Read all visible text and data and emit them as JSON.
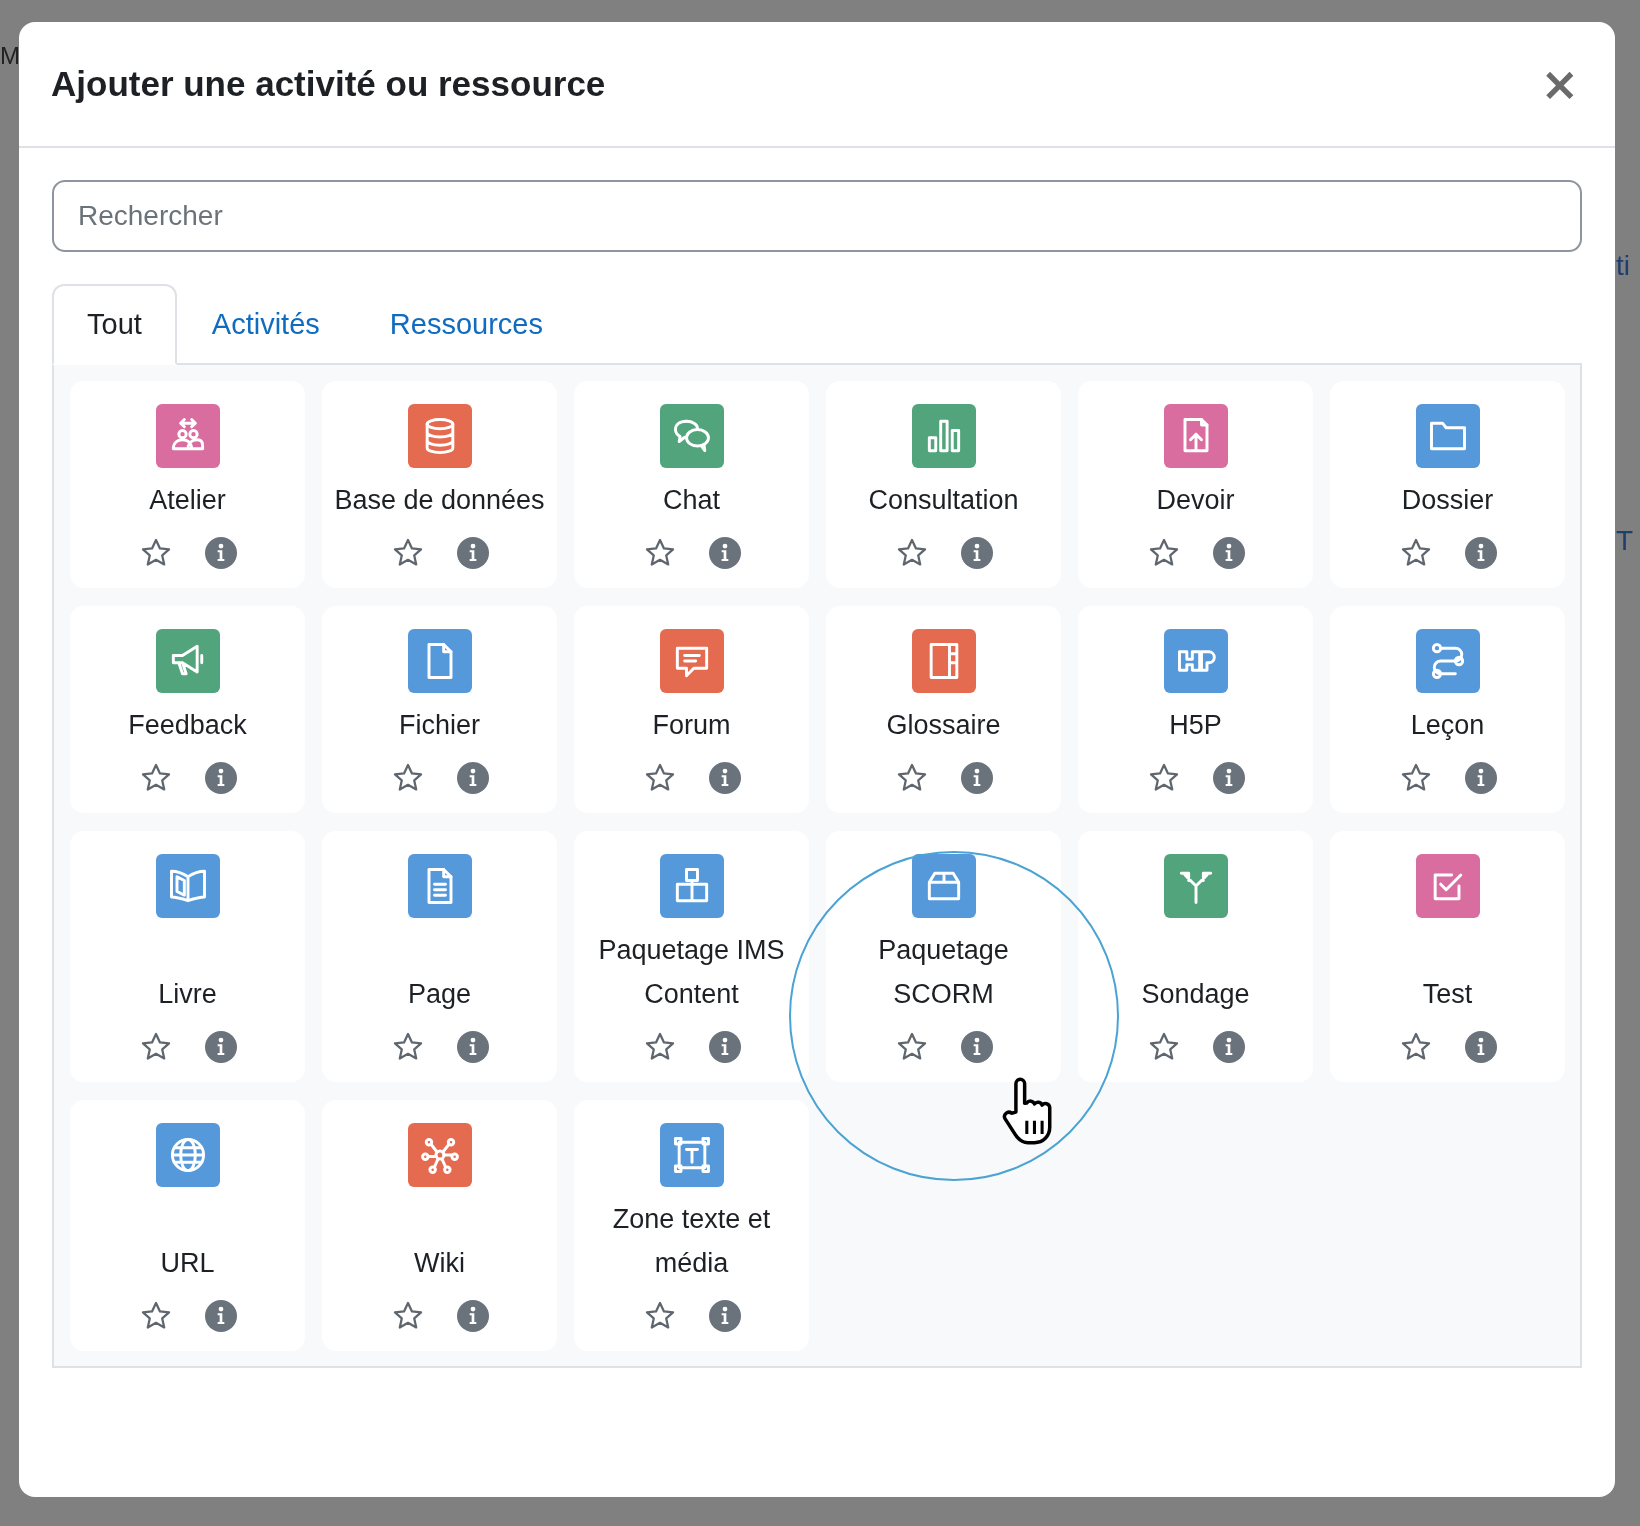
{
  "background": {
    "left_text": "M",
    "right_texts": [
      "ti",
      "T"
    ]
  },
  "dialog": {
    "title": "Ajouter une activité ou ressource",
    "close": "×"
  },
  "search": {
    "placeholder": "Rechercher"
  },
  "tabs": [
    {
      "label": "Tout",
      "selected": true
    },
    {
      "label": "Activités",
      "selected": false
    },
    {
      "label": "Ressources",
      "selected": false
    }
  ],
  "items": [
    {
      "label": "Atelier",
      "kind": "workshop",
      "color": "#d96da0",
      "starred": false
    },
    {
      "label": "Base de données",
      "kind": "database",
      "color": "#e46a50",
      "starred": false
    },
    {
      "label": "Chat",
      "kind": "chat",
      "color": "#51a47b",
      "starred": false
    },
    {
      "label": "Consultation",
      "kind": "chart",
      "color": "#51a47b",
      "starred": false
    },
    {
      "label": "Devoir",
      "kind": "upload",
      "color": "#d96da0",
      "starred": false
    },
    {
      "label": "Dossier",
      "kind": "folder",
      "color": "#5599db",
      "starred": false
    },
    {
      "label": "Feedback",
      "kind": "megaphone",
      "color": "#51a47b",
      "starred": false
    },
    {
      "label": "Fichier",
      "kind": "file",
      "color": "#5599db",
      "starred": false
    },
    {
      "label": "Forum",
      "kind": "forum",
      "color": "#e46a50",
      "starred": false
    },
    {
      "label": "Glossaire",
      "kind": "notebook",
      "color": "#e46a50",
      "starred": false
    },
    {
      "label": "H5P",
      "kind": "blocks",
      "color": "#5599db",
      "starred": false
    },
    {
      "label": "Leçon",
      "kind": "route",
      "color": "#5599db",
      "starred": false
    },
    {
      "label": "Livre",
      "kind": "book",
      "color": "#5599db",
      "starred": false
    },
    {
      "label": "Page",
      "kind": "page",
      "color": "#5599db",
      "starred": false
    },
    {
      "label": "Paquetage IMS Content",
      "kind": "boxes",
      "color": "#5599db",
      "starred": false
    },
    {
      "label": "Paquetage SCORM",
      "kind": "box",
      "color": "#5599db",
      "starred": false
    },
    {
      "label": "Sondage",
      "kind": "signpost",
      "color": "#51a47b",
      "starred": false
    },
    {
      "label": "Test",
      "kind": "checkbox",
      "color": "#d96da0",
      "starred": false
    },
    {
      "label": "URL",
      "kind": "globe",
      "color": "#5599db",
      "starred": false
    },
    {
      "label": "Wiki",
      "kind": "network",
      "color": "#e46a50",
      "starred": false
    },
    {
      "label": "Zone texte et média",
      "kind": "frame",
      "color": "#5599db",
      "starred": false
    }
  ]
}
